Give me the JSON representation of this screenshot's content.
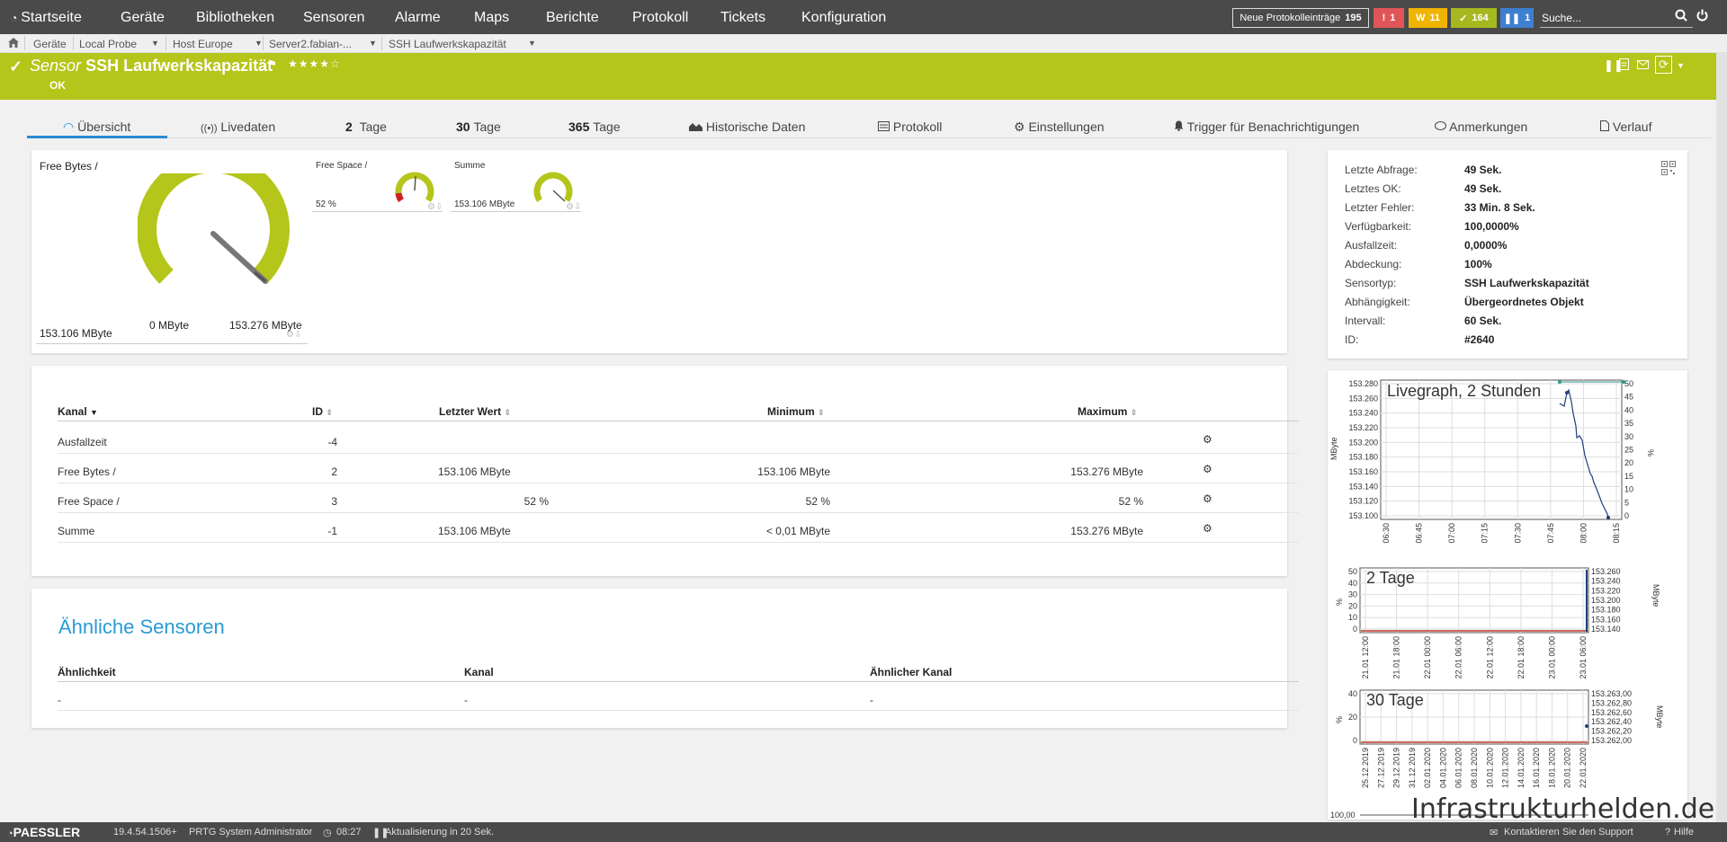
{
  "nav": {
    "items": [
      "Startseite",
      "Geräte",
      "Bibliotheken",
      "Sensoren",
      "Alarme",
      "Maps",
      "Berichte",
      "Protokoll",
      "Tickets",
      "Konfiguration"
    ],
    "protocol_label": "Neue Protokolleinträge",
    "protocol_count": "195",
    "badge_red": "1",
    "badge_yellow": "11",
    "badge_green": "164",
    "badge_blue": "1",
    "search_placeholder": "Suche..."
  },
  "breadcrumb": [
    "Geräte",
    "Local Probe",
    "Host Europe",
    "Server2.fabian-...",
    "SSH Laufwerkskapazität"
  ],
  "header": {
    "prefix": "Sensor",
    "name": "SSH Laufwerkskapazität",
    "stars": "★★★★☆",
    "status": "OK"
  },
  "tabs": [
    {
      "num": "",
      "label": "Übersicht"
    },
    {
      "num": "",
      "label": "Livedaten"
    },
    {
      "num": "2",
      "label": "Tage"
    },
    {
      "num": "30",
      "label": "Tage"
    },
    {
      "num": "365",
      "label": "Tage"
    },
    {
      "num": "",
      "label": "Historische Daten"
    },
    {
      "num": "",
      "label": "Protokoll"
    },
    {
      "num": "",
      "label": "Einstellungen"
    },
    {
      "num": "",
      "label": "Trigger für Benachrichtigungen"
    },
    {
      "num": "",
      "label": "Anmerkungen"
    },
    {
      "num": "",
      "label": "Verlauf"
    }
  ],
  "gauges": {
    "main_title": "Free Bytes /",
    "main_value": "153.106 MByte",
    "main_min": "0 MByte",
    "main_max": "153.276 MByte",
    "main_level": 0.999,
    "g2_title": "Free Space /",
    "g2_value": "52 %",
    "g2_level": 0.52,
    "g3_title": "Summe",
    "g3_value": "153.106 MByte",
    "g3_level": 0.999
  },
  "channels": {
    "headers": [
      "Kanal",
      "ID",
      "Letzter Wert",
      "Minimum",
      "Maximum"
    ],
    "rows": [
      {
        "name": "Ausfallzeit",
        "id": "-4",
        "last": "",
        "min": "",
        "max": ""
      },
      {
        "name": "Free Bytes /",
        "id": "2",
        "last": "153.106 MByte",
        "min": "153.106 MByte",
        "max": "153.276 MByte"
      },
      {
        "name": "Free Space /",
        "id": "3",
        "last": "52 %",
        "min": "52 %",
        "max": "52 %"
      },
      {
        "name": "Summe",
        "id": "-1",
        "last": "153.106 MByte",
        "min": "< 0,01 MByte",
        "max": "153.276 MByte"
      }
    ]
  },
  "similar": {
    "title": "Ähnliche Sensoren",
    "headers": [
      "Ähnlichkeit",
      "Kanal",
      "Ähnlicher Kanal"
    ],
    "row": [
      "-",
      "-",
      "-"
    ]
  },
  "info": [
    {
      "label": "Letzte Abfrage:",
      "value": "49 Sek."
    },
    {
      "label": "Letztes OK:",
      "value": "49 Sek."
    },
    {
      "label": "Letzter Fehler:",
      "value": "33 Min. 8 Sek."
    },
    {
      "label": "Verfügbarkeit:",
      "value": "100,0000%"
    },
    {
      "label": "Ausfallzeit:",
      "value": "0,0000%"
    },
    {
      "label": "Abdeckung:",
      "value": "100%"
    },
    {
      "label": "Sensortyp:",
      "value": "SSH Laufwerkskapazität"
    },
    {
      "label": "Abhängigkeit:",
      "value": "Übergeordnetes Objekt"
    },
    {
      "label": "Intervall:",
      "value": "60 Sek."
    },
    {
      "label": "ID:",
      "value": "#2640"
    }
  ],
  "graphs": {
    "live_title": "Livegraph, 2 Stunden",
    "live_y_left": [
      "153.280",
      "153.260",
      "153.240",
      "153.220",
      "153.200",
      "153.180",
      "153.160",
      "153.140",
      "153.120",
      "153.100"
    ],
    "live_y_right": [
      "50",
      "45",
      "40",
      "35",
      "30",
      "25",
      "20",
      "15",
      "10",
      "5",
      "0"
    ],
    "live_x": [
      "06:30",
      "06:45",
      "07:00",
      "07:15",
      "07:30",
      "07:45",
      "08:00",
      "08:15"
    ],
    "unit_mbyte": "MByte",
    "unit_pct": "%",
    "d2_title": "2 Tage",
    "d2_y_left": [
      "50",
      "40",
      "30",
      "20",
      "10",
      "0"
    ],
    "d2_y_right": [
      "153.260",
      "153.240",
      "153.220",
      "153.200",
      "153.180",
      "153.160",
      "153.140"
    ],
    "d2_x": [
      "21.01 12:00",
      "21.01 18:00",
      "22.01 00:00",
      "22.01 06:00",
      "22.01 12:00",
      "22.01 18:00",
      "23.01 00:00",
      "23.01 06:00"
    ],
    "d30_title": "30 Tage",
    "d30_y_left": [
      "40",
      "20",
      "0"
    ],
    "d30_y_right": [
      "153.263,00",
      "153.262,80",
      "153.262,60",
      "153.262,40",
      "153.262,20",
      "153.262,00"
    ],
    "d30_x": [
      "25.12.2019",
      "27.12.2019",
      "29.12.2019",
      "31.12.2019",
      "02.01.2020",
      "04.01.2020",
      "06.01.2020",
      "08.01.2020",
      "10.01.2020",
      "12.01.2020",
      "14.01.2020",
      "16.01.2020",
      "18.01.2020",
      "20.01.2020",
      "22.01.2020"
    ],
    "d365_y_top": "100,00"
  },
  "footer": {
    "brand": "PAESSLER",
    "version": "19.4.54.1506+",
    "user": "PRTG System Administrator",
    "time": "08:27",
    "refresh": "Aktualisierung in 20 Sek.",
    "contact": "Kontaktieren Sie den Support",
    "help": "Hilfe"
  },
  "watermark": "Infrastrukturhelden.de",
  "colors": {
    "accent_green": "#b5c51a",
    "nav_bg": "#4a4a4a",
    "link_blue": "#2a9bd4"
  }
}
